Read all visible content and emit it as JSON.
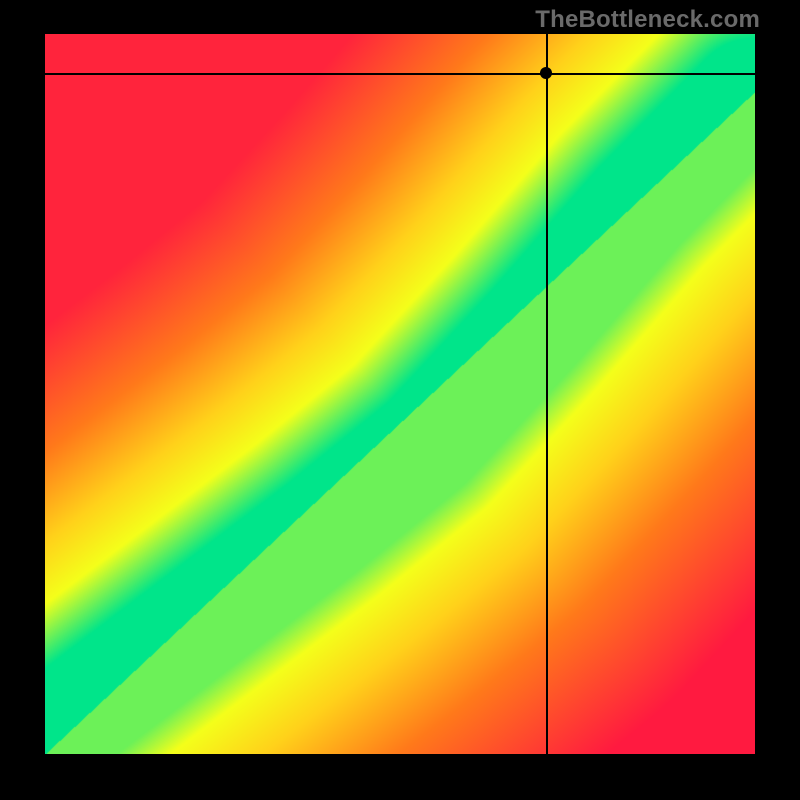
{
  "watermark": "TheBottleneck.com",
  "chart_data": {
    "type": "heatmap",
    "title": "",
    "xlabel": "",
    "ylabel": "",
    "xlim": [
      0,
      100
    ],
    "ylim": [
      0,
      100
    ],
    "axes_visible": false,
    "grid": false,
    "crosshair": {
      "x": 70.5,
      "y": 94.6
    },
    "main_diagonal": {
      "description": "optimal-match band (green)",
      "path": [
        {
          "x": 0,
          "y": 0,
          "v": 100
        },
        {
          "x": 20,
          "y": 15,
          "v": 100
        },
        {
          "x": 40,
          "y": 30,
          "v": 100
        },
        {
          "x": 55,
          "y": 42,
          "v": 100
        },
        {
          "x": 70,
          "y": 58,
          "v": 100
        },
        {
          "x": 85,
          "y": 75,
          "v": 100
        },
        {
          "x": 100,
          "y": 90,
          "v": 100
        }
      ],
      "band_half_width": 6
    },
    "field_samples_note": "value ≈ 100 on diagonal band → falls off with distance; upper-left & lower-right corners ≈ 0",
    "field_samples": [
      {
        "x": 5,
        "y": 95,
        "v": 2
      },
      {
        "x": 20,
        "y": 80,
        "v": 8
      },
      {
        "x": 50,
        "y": 50,
        "v": 70
      },
      {
        "x": 60,
        "y": 45,
        "v": 98
      },
      {
        "x": 80,
        "y": 65,
        "v": 100
      },
      {
        "x": 95,
        "y": 80,
        "v": 100
      },
      {
        "x": 95,
        "y": 10,
        "v": 6
      },
      {
        "x": 10,
        "y": 5,
        "v": 40
      },
      {
        "x": 70.5,
        "y": 94.6,
        "v": 35
      }
    ],
    "color_stops": [
      {
        "v": 0,
        "color": "#ff1a40"
      },
      {
        "v": 40,
        "color": "#ff7a1a"
      },
      {
        "v": 65,
        "color": "#ffd21a"
      },
      {
        "v": 82,
        "color": "#f4ff1a"
      },
      {
        "v": 100,
        "color": "#00e58a"
      }
    ]
  }
}
